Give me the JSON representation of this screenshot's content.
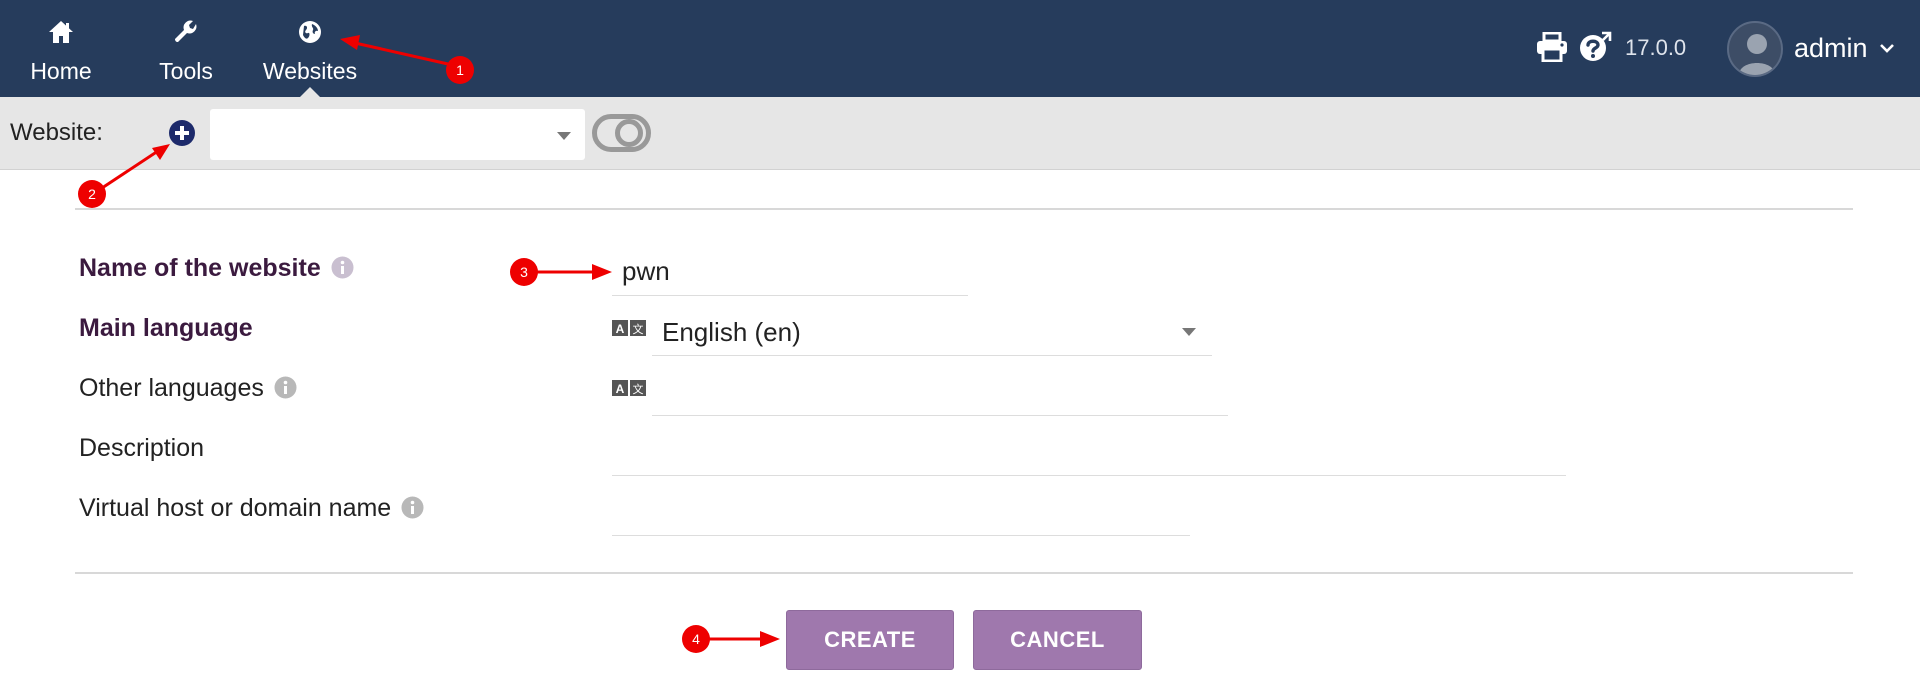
{
  "nav": {
    "menu": [
      {
        "label": "Home",
        "icon": "home-icon"
      },
      {
        "label": "Tools",
        "icon": "wrench-icon"
      },
      {
        "label": "Websites",
        "icon": "globe-icon",
        "active": true
      }
    ],
    "version": "17.0.0",
    "user": {
      "name": "admin",
      "avatar": "avatar-icon"
    },
    "tool_icons": [
      "printer-icon",
      "help-icon"
    ]
  },
  "toolbar": {
    "website_label": "Website:",
    "website_select_value": "",
    "add_icon": "plus-circle-icon",
    "toggle_state": "off"
  },
  "form": {
    "fields": [
      {
        "label": "Name of the website",
        "required": true,
        "info": true,
        "value": "pwn"
      },
      {
        "label": "Main language",
        "required": true,
        "info": false,
        "value": "English (en)"
      },
      {
        "label": "Other languages",
        "required": false,
        "info": true,
        "value": ""
      },
      {
        "label": "Description",
        "required": false,
        "info": false,
        "value": ""
      },
      {
        "label": "Virtual host or domain name",
        "required": false,
        "info": true,
        "value": ""
      }
    ],
    "buttons": {
      "create": "CREATE",
      "cancel": "CANCEL"
    }
  },
  "annotations": {
    "markers": [
      "1",
      "2",
      "3",
      "4"
    ],
    "color": "#ee0000"
  },
  "colors": {
    "nav_bg": "#263c5c",
    "toolbar_bg": "#e6e6e6",
    "button": "#9f78ad",
    "required_label": "#3b1a3f"
  }
}
